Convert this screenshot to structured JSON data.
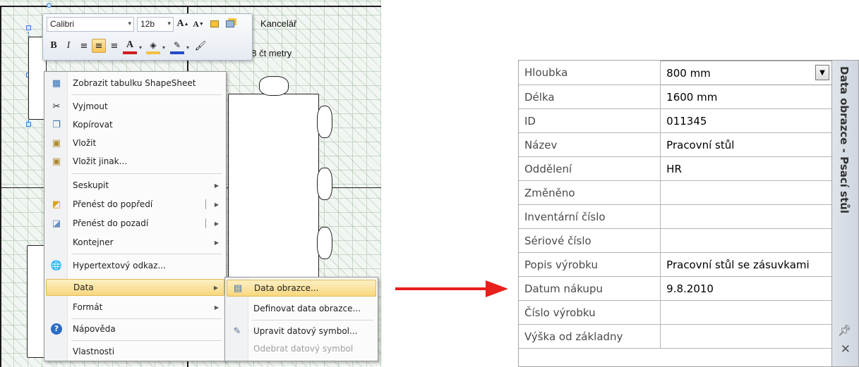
{
  "canvas": {
    "label_office": "Kancelář",
    "label_area": "18 čt metry"
  },
  "mini_toolbar": {
    "font_name": "Calibri",
    "font_size": "12b"
  },
  "context_menu": {
    "items": [
      {
        "label": "Zobrazit tabulku ShapeSheet",
        "icon": "shapesheet-icon"
      },
      {
        "label": "Vyjmout",
        "icon": "scissors-icon"
      },
      {
        "label": "Kopírovat",
        "icon": "copy-icon"
      },
      {
        "label": "Vložit",
        "icon": "paste-icon"
      },
      {
        "label": "Vložit jinak...",
        "icon": "paste-special-icon"
      },
      {
        "label": "Seskupit",
        "icon": ""
      },
      {
        "label": "Přenést do popředí",
        "icon": "bring-forward-icon"
      },
      {
        "label": "Přenést do pozadí",
        "icon": "send-backward-icon"
      },
      {
        "label": "Kontejner",
        "icon": ""
      },
      {
        "label": "Hypertextový odkaz...",
        "icon": "hyperlink-icon"
      },
      {
        "label": "Data",
        "icon": ""
      },
      {
        "label": "Formát",
        "icon": ""
      },
      {
        "label": "Nápověda",
        "icon": "help-icon"
      },
      {
        "label": "Vlastnosti",
        "icon": ""
      }
    ]
  },
  "data_submenu": {
    "items": [
      {
        "label": "Data obrazce...",
        "enabled": true
      },
      {
        "label": "Definovat data obrazce...",
        "enabled": true
      },
      {
        "label": "Upravit datový symbol...",
        "enabled": true
      },
      {
        "label": "Odebrat datový symbol",
        "enabled": false
      }
    ]
  },
  "shape_data_panel": {
    "title": "Data obrazce - Psací stůl",
    "rows": [
      {
        "label": "Hloubka",
        "value": "800 mm"
      },
      {
        "label": "Délka",
        "value": "1600 mm"
      },
      {
        "label": "ID",
        "value": "011345"
      },
      {
        "label": "Název",
        "value": "Pracovní stůl"
      },
      {
        "label": "Oddělení",
        "value": "HR"
      },
      {
        "label": "Změněno",
        "value": ""
      },
      {
        "label": "Inventární číslo",
        "value": ""
      },
      {
        "label": "Sériové číslo",
        "value": ""
      },
      {
        "label": "Popis výrobku",
        "value": "Pracovní stůl se zásuvkami"
      },
      {
        "label": "Datum nákupu",
        "value": "9.8.2010"
      },
      {
        "label": "Číslo výrobku",
        "value": ""
      },
      {
        "label": "Výška od základny",
        "value": ""
      }
    ]
  },
  "colors": {
    "menu_highlight": "#f8d77e",
    "arrow": "#e8201c",
    "selection": "#3b7fd0"
  }
}
